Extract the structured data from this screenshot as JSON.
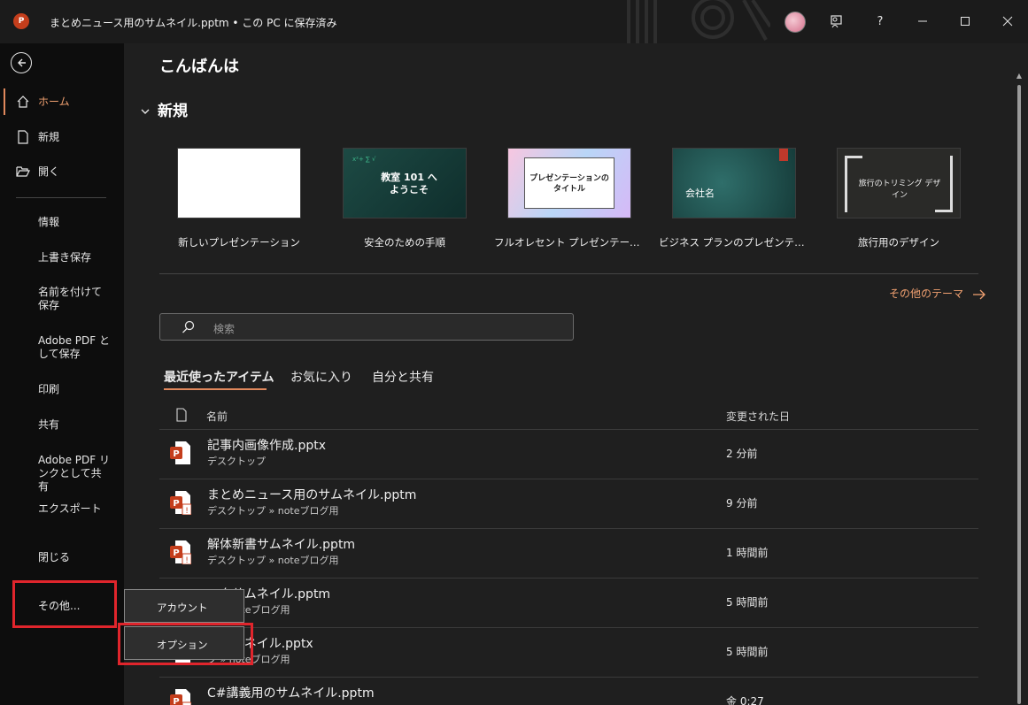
{
  "titlebar": {
    "app_logo": "P",
    "doc_title": "まとめニュース用のサムネイル.pptm • この PC に保存済み",
    "buttons": [
      "feedback-icon",
      "help-icon",
      "minimize-icon",
      "maximize-icon",
      "close-icon"
    ],
    "help_label": "?"
  },
  "leftnav": {
    "primary": [
      {
        "icon": "home-icon",
        "label": "ホーム",
        "active": true
      },
      {
        "icon": "new-file-icon",
        "label": "新規"
      },
      {
        "icon": "folder-open-icon",
        "label": "開く"
      }
    ],
    "secondary": [
      "情報",
      "上書き保存",
      "名前を付けて保存",
      "Adobe PDF として保存",
      "印刷",
      "共有",
      "Adobe PDF リンクとして共有",
      "エクスポート",
      "閉じる"
    ],
    "more_label": "その他..."
  },
  "main": {
    "greeting": "こんばんは",
    "new_section": "新規",
    "templates": [
      {
        "caption": "新しいプレゼンテーション",
        "thumb_text": ""
      },
      {
        "caption": "安全のための手順",
        "thumb_text": "教室 101 へ ようこそ"
      },
      {
        "caption": "フルオレセント プレゼンテーション",
        "thumb_text": "プレゼンテーションの タイトル"
      },
      {
        "caption": "ビジネス プランのプレゼンテーシ…",
        "thumb_text": "会社名"
      },
      {
        "caption": "旅行用のデザイン",
        "thumb_text": "旅行のトリミング デザイン"
      }
    ],
    "more_themes": "その他のテーマ",
    "search_placeholder": "検索",
    "tabs": [
      "最近使ったアイテム",
      "お気に入り",
      "自分と共有"
    ],
    "columns": {
      "name": "名前",
      "modified": "変更された日"
    },
    "files": [
      {
        "name": "記事内画像作成.pptx",
        "path": "デスクトップ",
        "modified": "2 分前",
        "warning": false
      },
      {
        "name": "まとめニュース用のサムネイル.pptm",
        "path": "デスクトップ » noteブログ用",
        "modified": "9 分前",
        "warning": true
      },
      {
        "name": "解体新書サムネイル.pptm",
        "path": "デスクトップ » noteブログ用",
        "modified": "1 時間前",
        "warning": true
      },
      {
        "name": "ックサムネイル.pptm",
        "path": "プ » noteブログ用",
        "modified": "5 時間前",
        "warning": true
      },
      {
        "name": "書サムネイル.pptx",
        "path": "プ » noteブログ用",
        "modified": "5 時間前",
        "warning": false
      },
      {
        "name": "C#講義用のサムネイル.pptm",
        "path": "",
        "modified": "金 0:27",
        "warning": true
      }
    ]
  },
  "popup": {
    "items": [
      "アカウント",
      "オプション"
    ]
  },
  "colors": {
    "accent": "#e0885c",
    "highlight_box": "#e0252c",
    "ppt_red": "#c43e1c"
  }
}
